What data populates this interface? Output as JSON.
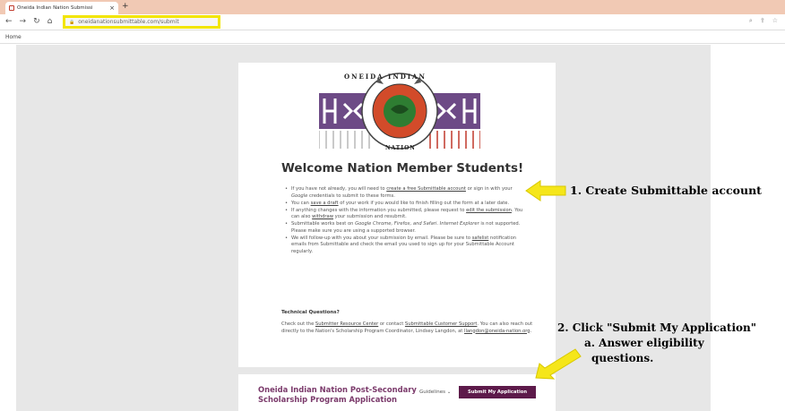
{
  "browser": {
    "tab_title": "Oneida Indian Nation Submissi",
    "tab_close": "×",
    "new_tab": "+",
    "url": "oneidanationsubmittable.com/submit",
    "bookmark_home": "Home"
  },
  "page": {
    "logo_text_top": "ONEIDA INDIAN",
    "logo_text_bottom": "NATION",
    "welcome_heading": "Welcome Nation Member Students!",
    "technical_heading": "Technical Questions?"
  },
  "application": {
    "title_line1": "Oneida Indian Nation Post-Secondary",
    "title_line2": "Scholarship Program Application",
    "guidelines_label": "Guidelines ⌄",
    "submit_label": "Submit My Application"
  },
  "annotations": {
    "step1": "1. Create Submittable account",
    "step2": "2. Click \"Submit My Application\"",
    "step2a_line1": "a. Answer eligibility",
    "step2a_line2": "questions."
  },
  "colors": {
    "tabbar": "#f1c9b4",
    "highlight": "#f2e500",
    "brand_purple": "#5d1a4a",
    "arrow_yellow": "#f5e61a"
  }
}
